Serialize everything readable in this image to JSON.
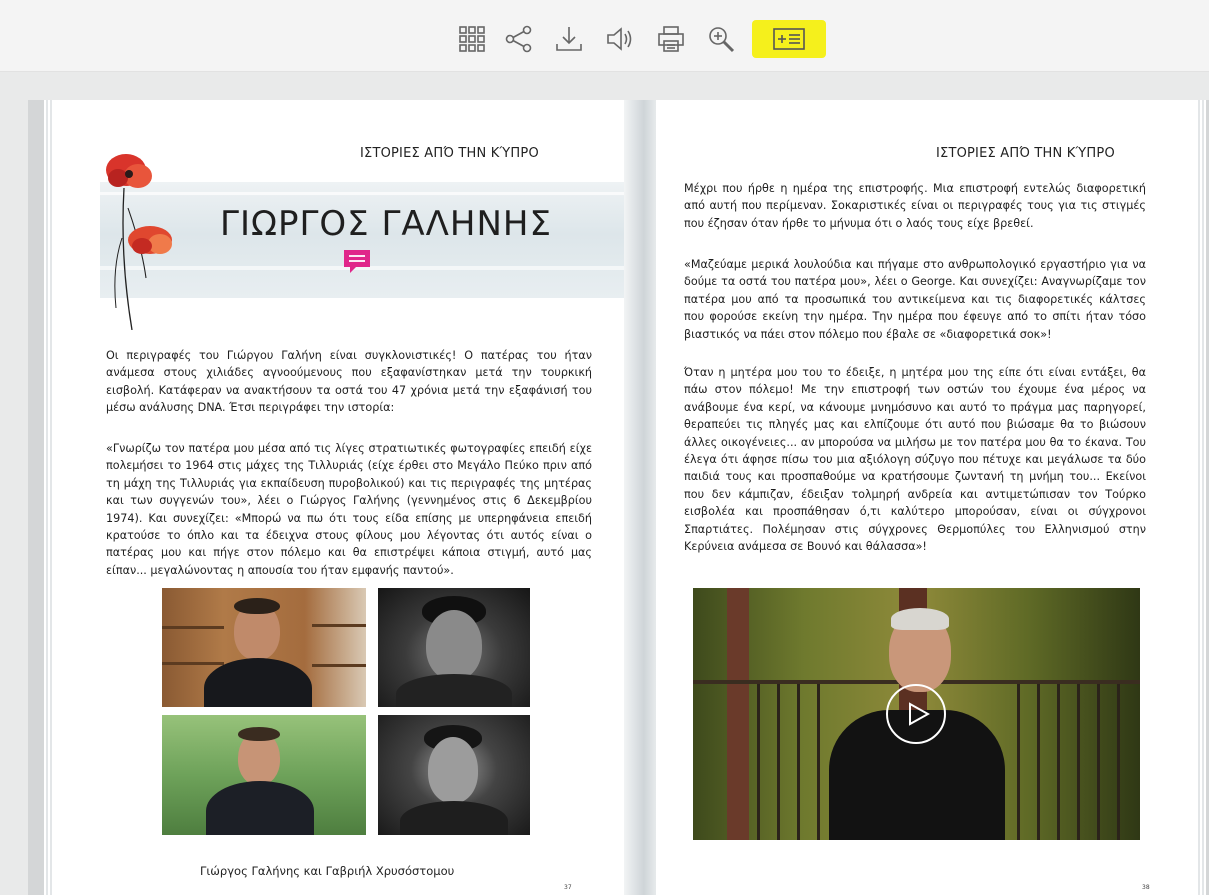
{
  "toolbar": {
    "items": [
      {
        "name": "grid-icon"
      },
      {
        "name": "share-icon"
      },
      {
        "name": "download-icon"
      },
      {
        "name": "sound-icon"
      },
      {
        "name": "print-icon"
      },
      {
        "name": "zoom-icon"
      },
      {
        "name": "add-note-icon",
        "highlight_color": "#f5f01c"
      }
    ]
  },
  "left_page": {
    "running_head": "ΙΣΤΟΡΙΕΣ ΑΠΌ ΤΗΝ ΚΎΠΡΟ",
    "title": "ΓΙΩΡΓΟΣ ΓΑΛΗΝΗΣ",
    "comment_icon_color": "#e0268a",
    "paragraphs": [
      "Οι περιγραφές του Γιώργου Γαλήνη είναι συγκλονιστικές! Ο πατέρας του ήταν ανάμεσα στους χιλιάδες αγνοούμενους που εξαφανίστηκαν μετά την τουρκική εισβολή. Κατάφεραν να ανακτήσουν τα οστά του 47 χρόνια μετά την εξαφάνισή του μέσω ανάλυσης DNA. Έτσι περιγράφει την ιστορία:",
      "«Γνωρίζω τον πατέρα μου μέσα από τις λίγες στρατιωτικές φωτογραφίες επειδή είχε πολεμήσει το 1964 στις μάχες της Τιλλυριάς (είχε έρθει στο Μεγάλο Πεύκο πριν από τη μάχη της Τιλλυριάς για εκπαίδευση πυροβολικού) και τις περιγραφές της μητέρας και των συγγενών του», λέει ο Γιώργος Γαλήνης (γεννημένος στις 6 Δεκεμβρίου 1974). Και συνεχίζει: «Μπορώ να πω ότι τους είδα επίσης με υπερηφάνεια επειδή κρατούσε το όπλο και τα έδειχνα στους φίλους μου λέγοντας ότι αυτός είναι ο πατέρας μου και πήγε στον πόλεμο και θα επιστρέψει κάποια στιγμή, αυτό μας είπαν... μεγαλώνοντας η απουσία του ήταν εμφανής παντού»."
    ],
    "caption": "Γιώργος Γαλήνης και Γαβριήλ Χρυσόστομου",
    "page_number": "37"
  },
  "right_page": {
    "running_head": "ΙΣΤΟΡΙΕΣ ΑΠΌ ΤΗΝ ΚΎΠΡΟ",
    "paragraphs": [
      "Μέχρι που ήρθε η ημέρα της επιστροφής. Μια επιστροφή εντελώς διαφορετική από αυτή που περίμεναν. Σοκαριστικές είναι οι περιγραφές τους για τις στιγμές που έζησαν όταν ήρθε το μήνυμα ότι ο λαός τους είχε βρεθεί.",
      "«Μαζεύαμε μερικά λουλούδια και πήγαμε στο ανθρωπολογικό εργαστήριο για να δούμε τα οστά του πατέρα μου», λέει ο George. Και συνεχίζει: Αναγνωρίζαμε τον πατέρα μου από τα προσωπικά του αντικείμενα και τις διαφορετικές κάλτσες που φορούσε εκείνη την ημέρα. Την ημέρα που έφευγε από το σπίτι ήταν τόσο βιαστικός να πάει στον πόλεμο που έβαλε σε «διαφορετικά σοκ»!",
      "Όταν η μητέρα μου του το έδειξε, η μητέρα μου της είπε ότι είναι εντάξει, θα πάω στον πόλεμο! Με την επιστροφή των οστών του έχουμε ένα μέρος να ανάβουμε ένα κερί, να κάνουμε μνημόσυνο και αυτό το πράγμα μας παρηγορεί, θεραπεύει τις πληγές μας και ελπίζουμε ότι αυτό που βιώσαμε θα το βιώσουν άλλες οικογένειες... αν μπορούσα να μιλήσω με τον πατέρα μου θα το έκανα. Του έλεγα ότι άφησε πίσω του μια αξιόλογη σύζυγο που πέτυχε και μεγάλωσε τα δύο παιδιά τους και προσπαθούμε να κρατήσουμε ζωντανή τη μνήμη του... Εκείνοι που δεν κάμπιζαν, έδειξαν τολμηρή ανδρεία και αντιμετώπισαν τον Τούρκο εισβολέα και προσπάθησαν ό,τι καλύτερο μπορούσαν, είναι οι σύγχρονοι Σπαρτιάτες. Πολέμησαν στις σύγχρονες Θερμοπύλες του Ελληνισμού στην Κερύνεια ανάμεσα σε Βουνό και θάλασσα»!"
    ],
    "video": {
      "play_icon": "play-icon"
    },
    "page_number": "38"
  }
}
